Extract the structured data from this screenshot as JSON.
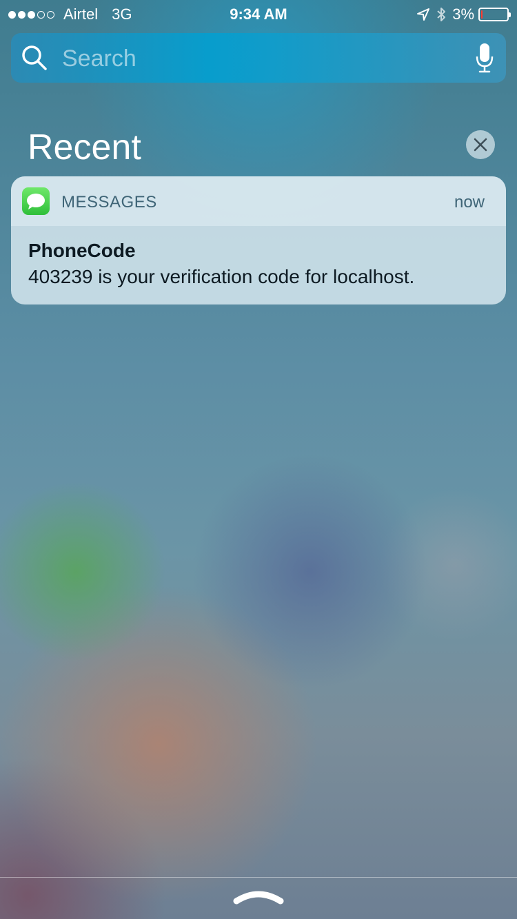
{
  "status_bar": {
    "signal_filled": 3,
    "signal_total": 5,
    "carrier": "Airtel",
    "network": "3G",
    "time": "9:34 AM",
    "battery_percent": "3%",
    "battery_level": 0.03,
    "battery_color": "#ff3b30",
    "icons": [
      "location-arrow-icon",
      "bluetooth-icon",
      "battery-icon"
    ]
  },
  "search": {
    "placeholder": "Search",
    "icons": [
      "search-icon",
      "microphone-icon"
    ]
  },
  "recent": {
    "title": "Recent",
    "clear_icon": "close-icon"
  },
  "notification": {
    "app_name": "MESSAGES",
    "app_icon": "messages-icon",
    "app_icon_color": "#34c759",
    "time": "now",
    "title": "PhoneCode",
    "body": "403239 is your verification code for localhost."
  },
  "bottom": {
    "grabber_icon": "chevron-up-icon"
  }
}
